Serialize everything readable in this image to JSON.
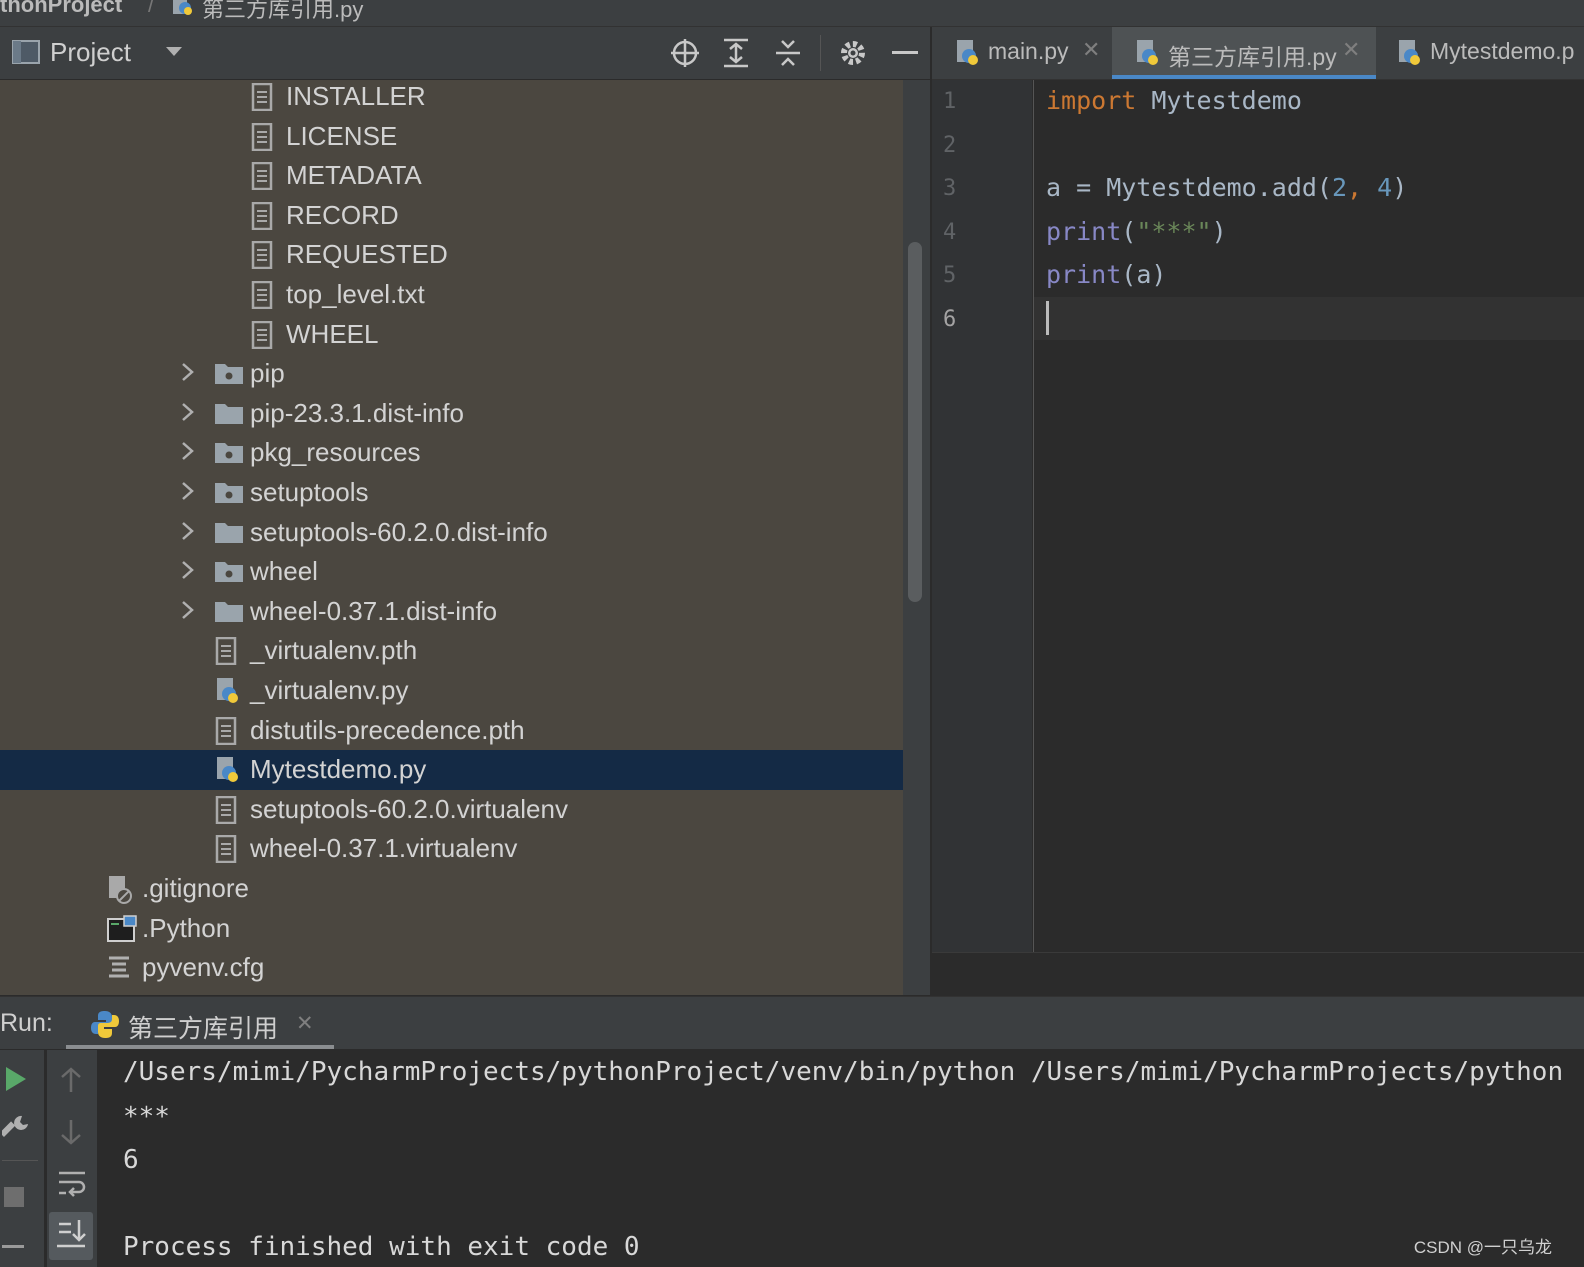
{
  "breadcrumb": {
    "project": "thonProject",
    "sep": "/",
    "file": "第三方库引用.py"
  },
  "project_panel": {
    "title": "Project"
  },
  "tree": [
    {
      "label": "INSTALLER",
      "type": "file",
      "indent": 2
    },
    {
      "label": "LICENSE",
      "type": "file",
      "indent": 2
    },
    {
      "label": "METADATA",
      "type": "file",
      "indent": 2
    },
    {
      "label": "RECORD",
      "type": "file",
      "indent": 2
    },
    {
      "label": "REQUESTED",
      "type": "file",
      "indent": 2
    },
    {
      "label": "top_level.txt",
      "type": "file",
      "indent": 2
    },
    {
      "label": "WHEEL",
      "type": "file",
      "indent": 2
    },
    {
      "label": "pip",
      "type": "package",
      "indent": 1
    },
    {
      "label": "pip-23.3.1.dist-info",
      "type": "folder",
      "indent": 1
    },
    {
      "label": "pkg_resources",
      "type": "package",
      "indent": 1
    },
    {
      "label": "setuptools",
      "type": "package",
      "indent": 1
    },
    {
      "label": "setuptools-60.2.0.dist-info",
      "type": "folder",
      "indent": 1
    },
    {
      "label": "wheel",
      "type": "package",
      "indent": 1
    },
    {
      "label": "wheel-0.37.1.dist-info",
      "type": "folder",
      "indent": 1
    },
    {
      "label": "_virtualenv.pth",
      "type": "file",
      "indent": 1
    },
    {
      "label": "_virtualenv.py",
      "type": "python",
      "indent": 1
    },
    {
      "label": "distutils-precedence.pth",
      "type": "file",
      "indent": 1
    },
    {
      "label": "Mytestdemo.py",
      "type": "python",
      "indent": 1,
      "selected": true
    },
    {
      "label": "setuptools-60.2.0.virtualenv",
      "type": "file",
      "indent": 1
    },
    {
      "label": "wheel-0.37.1.virtualenv",
      "type": "file",
      "indent": 1
    },
    {
      "label": ".gitignore",
      "type": "gitignore",
      "indent": 0
    },
    {
      "label": ".Python",
      "type": "exec",
      "indent": 0
    },
    {
      "label": "pyvenv.cfg",
      "type": "cfg",
      "indent": 0
    }
  ],
  "tabs": [
    {
      "label": "main.py",
      "active": false
    },
    {
      "label": "第三方库引用.py",
      "active": true
    },
    {
      "label": "Mytestdemo.p",
      "active": false
    }
  ],
  "code": {
    "line_numbers": [
      "1",
      "2",
      "3",
      "4",
      "5",
      "6"
    ],
    "l1_kw": "import",
    "l1_rest": " Mytestdemo",
    "l3_a": "a = Mytestdemo.add(",
    "l3_n1": "2",
    "l3_comma": ", ",
    "l3_n2": "4",
    "l3_close": ")",
    "l4_fn": "print",
    "l4_open": "(",
    "l4_str": "\"***\"",
    "l4_close": ")",
    "l5_fn": "print",
    "l5_rest": "(a)"
  },
  "run": {
    "label": "Run:",
    "tab_label": "第三方库引用",
    "output": [
      "/Users/mimi/PycharmProjects/pythonProject/venv/bin/python /Users/mimi/PycharmProjects/python",
      "***",
      "6",
      "",
      "Process finished with exit code 0"
    ]
  },
  "watermark": "CSDN @一只乌龙"
}
